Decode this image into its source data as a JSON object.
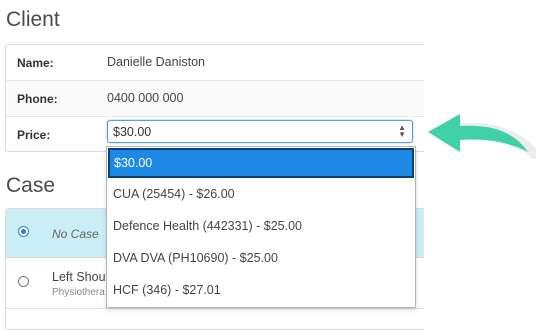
{
  "client": {
    "title": "Client",
    "rows": [
      {
        "label": "Name:",
        "value": "Danielle Daniston"
      },
      {
        "label": "Phone:",
        "value": "0400 000 000"
      },
      {
        "label": "Price:"
      }
    ],
    "price_select": {
      "value": "$30.00",
      "options": [
        "$30.00",
        "CUA (25454) - $26.00",
        "Defence Health (442331) - $25.00",
        "DVA DVA (PH10690) - $25.00",
        "HCF (346) - $27.01"
      ],
      "highlighted_index": 0
    }
  },
  "case": {
    "title": "Case",
    "options": [
      {
        "label": "No Case",
        "selected": true
      },
      {
        "label": "Left Shou",
        "sublabel": "Physiothera",
        "selected": false
      }
    ]
  },
  "colors": {
    "highlight": "#1e88e5",
    "selected_row_bg": "#c9eef6",
    "arrow": "#3fd1a8"
  },
  "icons": {
    "pointer": "green-arrow-icon",
    "select": "updown-chevron-icon"
  }
}
